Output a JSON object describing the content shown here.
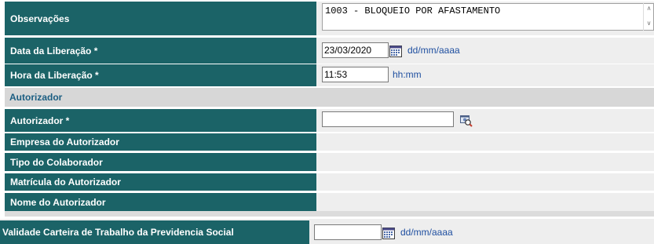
{
  "observacoes": {
    "label": "Observações",
    "value": "1003 - BLOQUEIO POR AFASTAMENTO"
  },
  "data_liberacao": {
    "label": "Data da Liberação *",
    "value": "23/03/2020",
    "format": "dd/mm/aaaa"
  },
  "hora_liberacao": {
    "label": "Hora da Liberação *",
    "value": "11:53",
    "format": "hh:mm"
  },
  "section_autorizador": "Autorizador",
  "autorizador": {
    "label": "Autorizador *",
    "value": ""
  },
  "empresa_autorizador": {
    "label": "Empresa do Autorizador",
    "value": ""
  },
  "tipo_colaborador": {
    "label": "Tipo do Colaborador",
    "value": ""
  },
  "matricula_autorizador": {
    "label": "Matrícula do Autorizador",
    "value": ""
  },
  "nome_autorizador": {
    "label": "Nome do Autorizador",
    "value": ""
  },
  "validade_ctps": {
    "label": "Validade Carteira de Trabalho da Previdencia Social",
    "value": "",
    "format": "dd/mm/aaaa"
  },
  "colors": {
    "label_bg": "#1b6367",
    "row_bg": "#eeeeee",
    "section_bg": "#d7d7d7",
    "hint": "#1f4fa0"
  },
  "icons": {
    "calendar": "calendar-icon",
    "lookup": "search-user-icon"
  }
}
